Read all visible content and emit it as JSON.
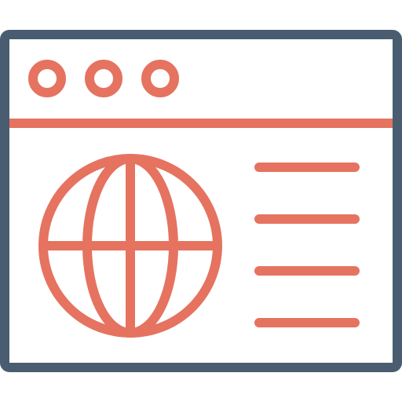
{
  "icon": {
    "name": "web-browser-globe-icon",
    "outline_color": "#4a5d70",
    "accent_color": "#e57360",
    "background_color": "#ffffff",
    "window_dots": [
      "circle-dot-icon",
      "circle-dot-icon",
      "circle-dot-icon"
    ],
    "content_lines": 4,
    "globe": "globe-icon"
  }
}
